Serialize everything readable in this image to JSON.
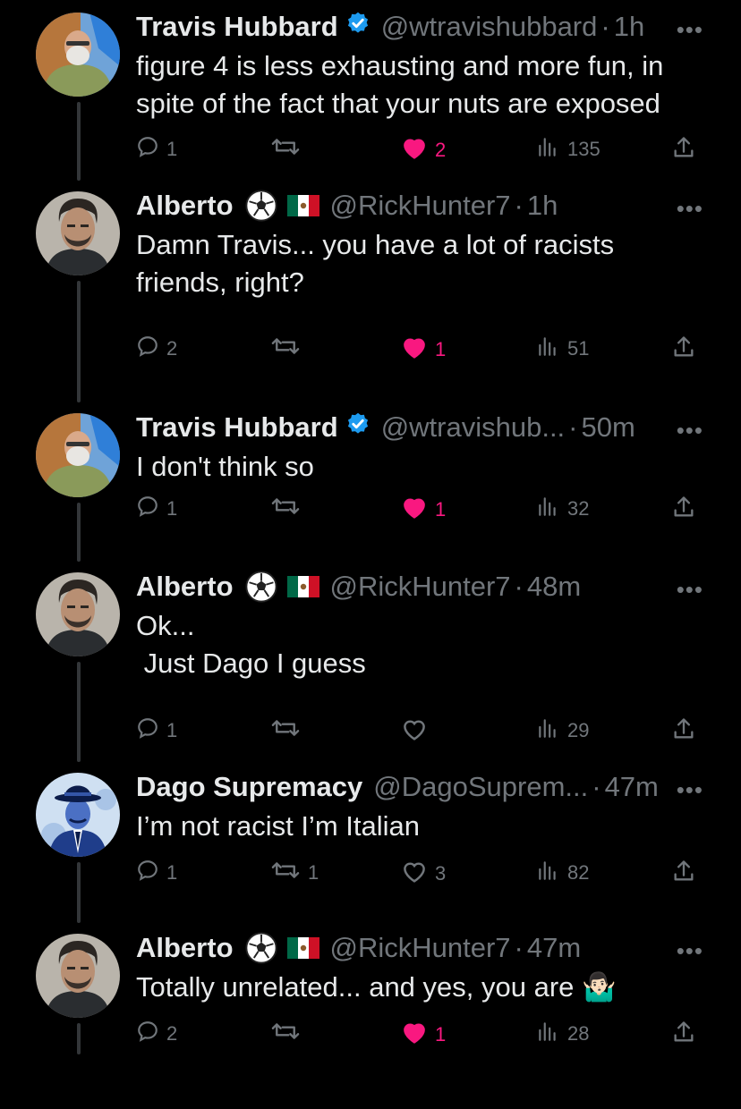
{
  "tweets": [
    {
      "name": "Travis Hubbard",
      "verified": true,
      "emoji": [],
      "handle": "@wtravishubbard",
      "time": "1h",
      "text": "figure 4 is less exhausting and more fun, in\nspite of the fact that your nuts are exposed",
      "replies": "1",
      "retweets": "",
      "likes": "2",
      "liked": true,
      "views": "135",
      "avatar": "travis"
    },
    {
      "name": "Alberto",
      "verified": false,
      "emoji": [
        "soccer-ball",
        "mexico-flag"
      ],
      "handle": "@RickHunter7",
      "time": "1h",
      "text": "Damn Travis... you have a lot of racists\nfriends, right?",
      "replies": "2",
      "retweets": "",
      "likes": "1",
      "liked": true,
      "views": "51",
      "avatar": "alberto"
    },
    {
      "name": "Travis Hubbard",
      "verified": true,
      "emoji": [],
      "handle": "@wtravishub...",
      "time": "50m",
      "text": "I don't think so",
      "replies": "1",
      "retweets": "",
      "likes": "1",
      "liked": true,
      "views": "32",
      "avatar": "travis"
    },
    {
      "name": "Alberto",
      "verified": false,
      "emoji": [
        "soccer-ball",
        "mexico-flag"
      ],
      "handle": "@RickHunter7",
      "time": "48m",
      "text": "Ok...\n Just Dago I guess",
      "replies": "1",
      "retweets": "",
      "likes": "",
      "liked": false,
      "views": "29",
      "avatar": "alberto"
    },
    {
      "name": "Dago Supremacy",
      "verified": false,
      "emoji": [],
      "handle": "@DagoSuprem...",
      "time": "47m",
      "text": "I’m not racist I’m Italian",
      "replies": "1",
      "retweets": "1",
      "likes": "3",
      "liked": false,
      "views": "82",
      "avatar": "dago"
    },
    {
      "name": "Alberto",
      "verified": false,
      "emoji": [
        "soccer-ball",
        "mexico-flag"
      ],
      "handle": "@RickHunter7",
      "time": "47m",
      "text": "Totally unrelated... and yes, you are 🤷🏻‍♂️",
      "replies": "2",
      "retweets": "",
      "likes": "1",
      "liked": true,
      "views": "28",
      "avatar": "alberto"
    }
  ],
  "colors": {
    "background": "#000000",
    "text": "#e7e9ea",
    "muted": "#71767b",
    "like": "#f91880",
    "verified": "#1d9bf0",
    "thread_line": "#333639"
  }
}
